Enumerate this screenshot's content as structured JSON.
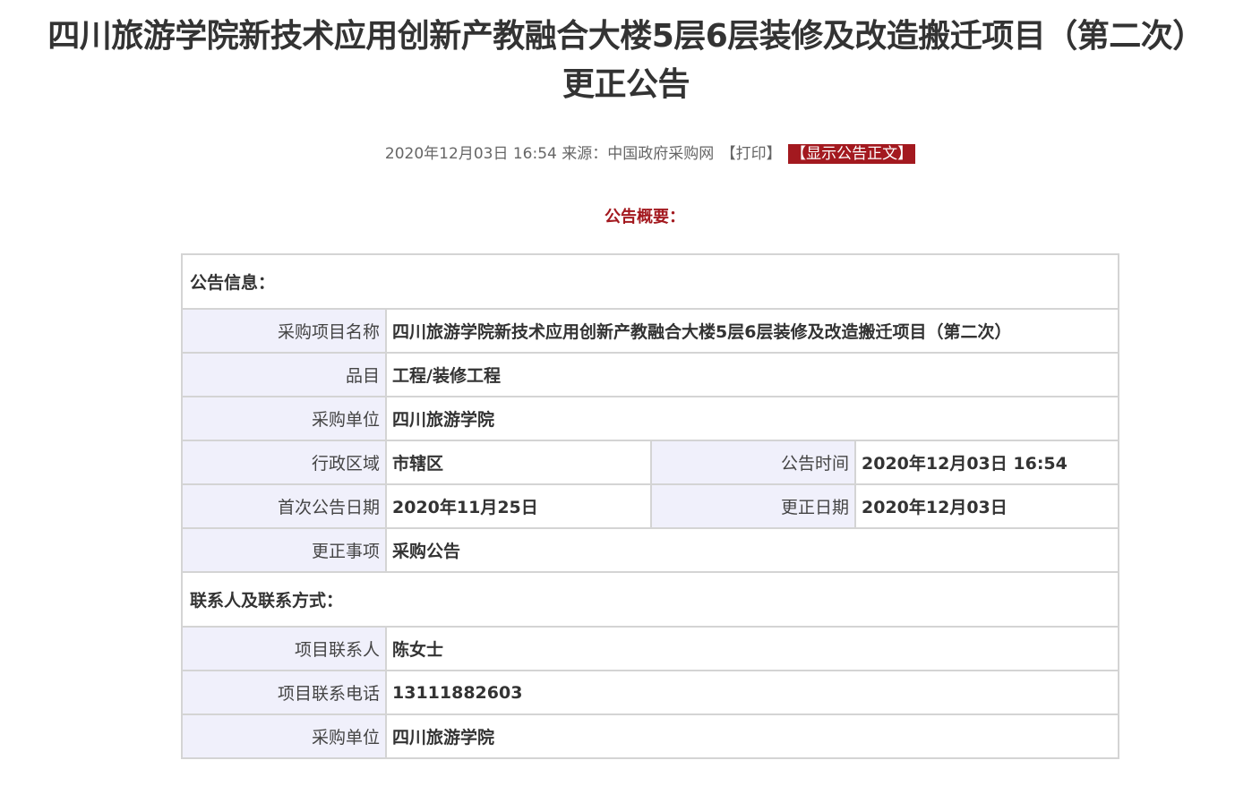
{
  "title": {
    "line1": "四川旅游学院新技术应用创新产教融合大楼5层6层装修及改造搬迁项目（第二次）",
    "line2": "更正公告"
  },
  "meta": {
    "datetime": "2020年12月03日 16:54",
    "source_label": "来源：",
    "source": "中国政府采购网",
    "print_label": "【打印】",
    "show_text_label": "【显示公告正文】"
  },
  "summary_heading": "公告概要：",
  "announcement_info": {
    "section_title": "公告信息：",
    "project_name_label": "采购项目名称",
    "project_name": "四川旅游学院新技术应用创新产教融合大楼5层6层装修及改造搬迁项目（第二次）",
    "category_label": "品目",
    "category": "工程/装修工程",
    "purchaser_label": "采购单位",
    "purchaser": "四川旅游学院",
    "region_label": "行政区域",
    "region": "市辖区",
    "announce_time_label": "公告时间",
    "announce_time": "2020年12月03日 16:54",
    "first_date_label": "首次公告日期",
    "first_date": "2020年11月25日",
    "correction_date_label": "更正日期",
    "correction_date": "2020年12月03日",
    "correction_item_label": "更正事项",
    "correction_item": "采购公告"
  },
  "contact_info": {
    "section_title": "联系人及联系方式：",
    "contact_person_label": "项目联系人",
    "contact_person": "陈女士",
    "contact_phone_label": "项目联系电话",
    "contact_phone": "13111882603",
    "purchaser_label": "采购单位",
    "purchaser": "四川旅游学院"
  },
  "colors": {
    "accent": "#a3191f",
    "label_bg": "#f0f0fb",
    "border": "#d4d4d4",
    "text": "#333333"
  }
}
